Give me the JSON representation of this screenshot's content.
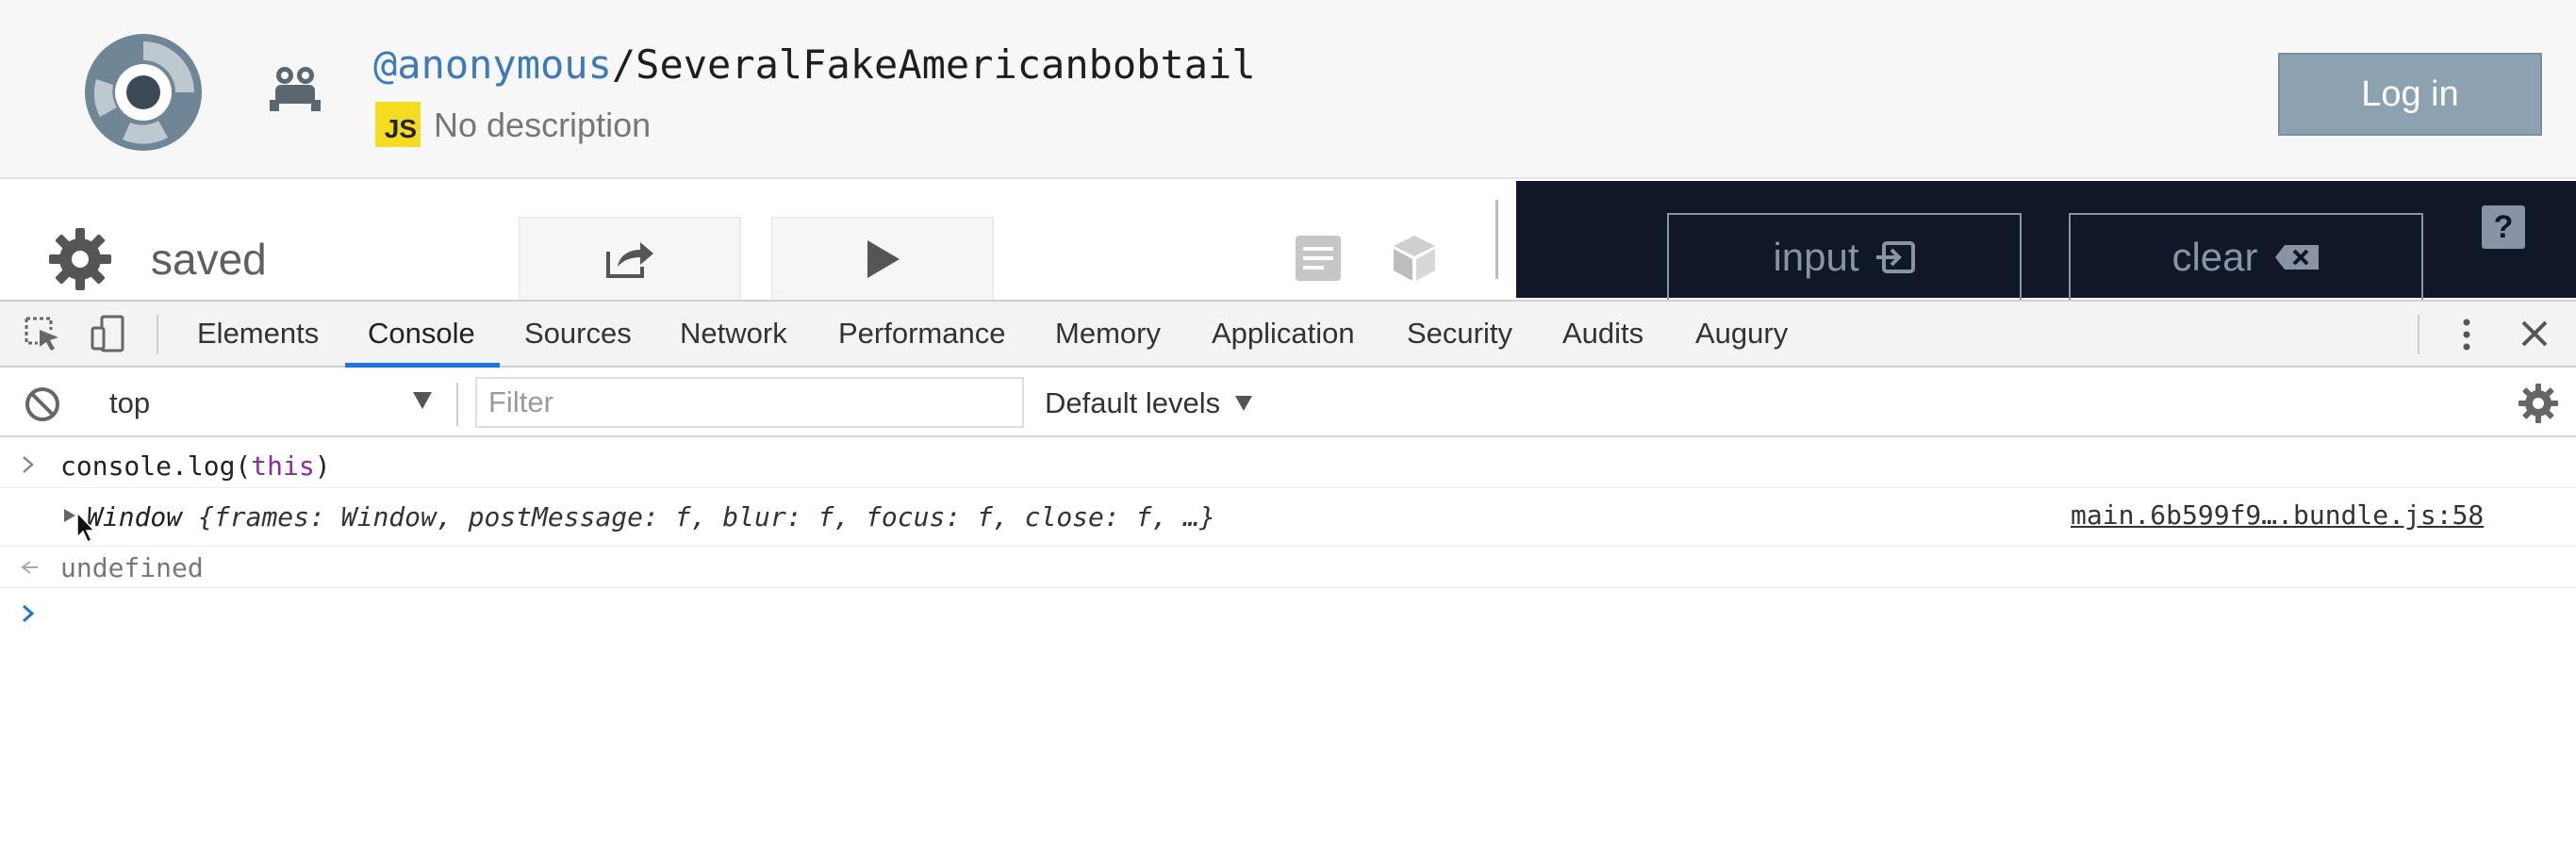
{
  "header": {
    "username": "@anonymous",
    "separator": "/",
    "repl_name": "SeveralFakeAmericanbobtail",
    "language_badge": "JS",
    "description": "No description",
    "login_label": "Log in"
  },
  "toolbar": {
    "status": "saved",
    "icons": [
      "gear-icon",
      "share-icon",
      "play-icon",
      "files-icon",
      "packages-icon"
    ]
  },
  "console_header": {
    "input_label": "input",
    "clear_label": "clear",
    "help_label": "?"
  },
  "devtools": {
    "tabs": [
      "Elements",
      "Console",
      "Sources",
      "Network",
      "Performance",
      "Memory",
      "Application",
      "Security",
      "Audits",
      "Augury"
    ],
    "active_tab": "Console",
    "context": "top",
    "filter_placeholder": "Filter",
    "levels_label": "Default levels"
  },
  "console": {
    "input_prefix": "console.log(",
    "input_keyword": "this",
    "input_suffix": ")",
    "output_object_name": "Window",
    "output_object_body": "{frames: Window, postMessage: f, blur: f, focus: f, close: f, …}",
    "output_source": "main.6b599f9….bundle.js:58",
    "return_value": "undefined"
  },
  "colors": {
    "accent_blue": "#1a73e8",
    "username_blue": "#3a7bbf",
    "dark_pane": "#0f1729",
    "login_button": "#8ca2b0",
    "js_badge": "#f5dd1e"
  }
}
